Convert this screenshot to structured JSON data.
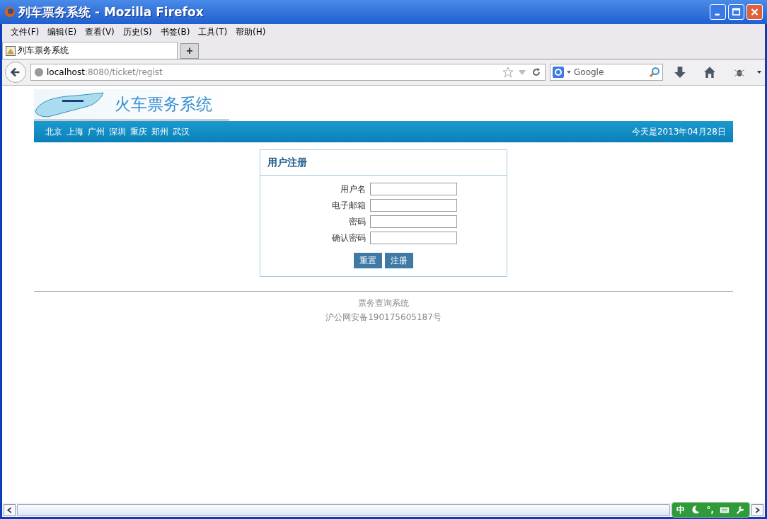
{
  "window": {
    "title": "列车票务系统 - Mozilla Firefox"
  },
  "menu": [
    "文件(F)",
    "编辑(E)",
    "查看(V)",
    "历史(S)",
    "书签(B)",
    "工具(T)",
    "帮助(H)"
  ],
  "tabs": [
    {
      "label": "列车票务系统",
      "selected": true
    }
  ],
  "new_tab": "+",
  "address": {
    "host": "localhost",
    "rest": ":8080/ticket/regist"
  },
  "search": {
    "placeholder": "Google"
  },
  "site": {
    "title": "火车票务系统",
    "cities": [
      "北京",
      "上海",
      "广州",
      "深圳",
      "重庆",
      "郑州",
      "武汉"
    ],
    "date": "今天是2013年04月28日"
  },
  "form": {
    "title": "用户注册",
    "fields": [
      {
        "label": "用户名"
      },
      {
        "label": "电子邮箱"
      },
      {
        "label": "密码"
      },
      {
        "label": "确认密码"
      }
    ],
    "buttons": [
      "重置",
      "注册"
    ]
  },
  "footer": [
    "票务查询系统",
    "沪公网安备190175605187号"
  ],
  "ime": {
    "mode": "中",
    "punct": "°,"
  }
}
